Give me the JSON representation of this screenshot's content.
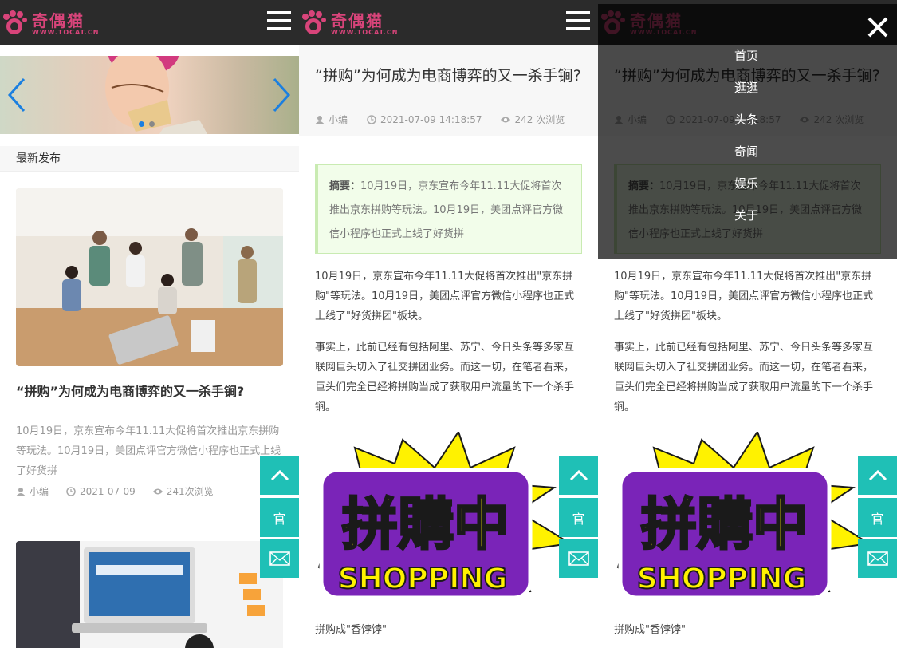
{
  "site": {
    "brand": "奇偶猫",
    "url": "WWW.TOCAT.CN"
  },
  "home": {
    "section_title": "最新发布",
    "post1": {
      "title": "“拼购”为何成为电商博弈的又一杀手锏?",
      "summary": "10月19日，京东宣布今年11.11大促将首次推出京东拼购等玩法。10月19日，美团点评官方微信小程序也正式上线了好货拼",
      "author": "小编",
      "date": "2021-07-09",
      "views": "241次浏览"
    }
  },
  "article": {
    "title": "“拼购”为何成为电商博弈的又一杀手锏?",
    "author": "小编",
    "datetime": "2021-07-09 14:18:57",
    "views": "242 次浏览",
    "summary_label": "摘要：",
    "summary_text": "10月19日，京东宣布今年11.11大促将首次推出京东拼购等玩法。10月19日，美团点评官方微信小程序也正式上线了好货拼",
    "para1": "10月19日，京东宣布今年11.11大促将首次推出\"京东拼购\"等玩法。10月19日，美团点评官方微信小程序也正式上线了\"好货拼团\"板块。",
    "para2": "事实上，此前已经有包括阿里、苏宁、今日头条等多家互联网巨头切入了社交拼团业务。而这一切，在笔者看来，巨头们完全已经将拼购当成了获取用户流量的下一个杀手锏。",
    "image_text_main": "拼購中",
    "image_text_sub": "SHOPPING",
    "caption": "拼购成\"香饽饽\""
  },
  "fab": {
    "guan": "官"
  },
  "nav": {
    "items": [
      "首页",
      "逛逛",
      "头条",
      "奇闻",
      "娱乐",
      "关于"
    ]
  },
  "colors": {
    "header_bg": "#2b2b2b",
    "brand": "#d8447a",
    "fab": "#1fc0b6",
    "summary_bg": "#f2fdea",
    "summary_border": "#c9ebb2",
    "slider_arrow": "#1b7fe0"
  }
}
